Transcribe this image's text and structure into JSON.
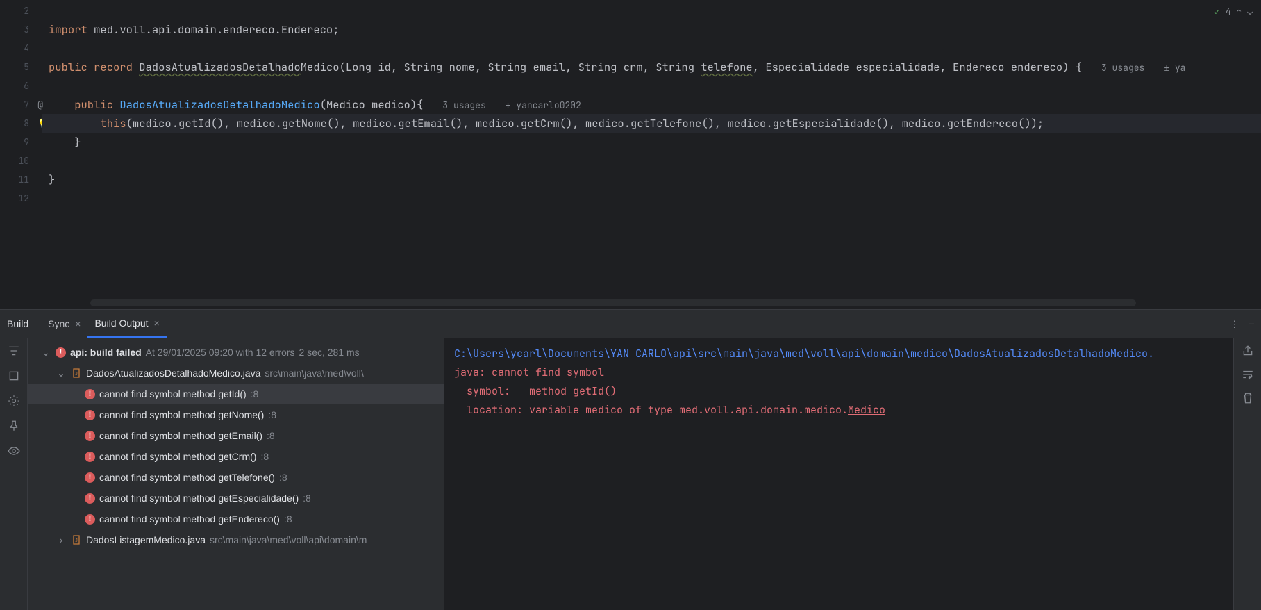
{
  "editor": {
    "status": {
      "count": "4"
    },
    "usages_record": "3 usages",
    "usages_ctor": "3 usages",
    "author_icon": "±",
    "author": "yancarlo0202",
    "lines": {
      "2": "",
      "3_kw": "import",
      "3_rest": " med.voll.api.domain.endereco.Endereco;",
      "4": "",
      "5_pre": "public record ",
      "5_under": "DadosAtualizadosDetalhado",
      "5_after": "Medico(Long id, String nome, String email, String crm, String ",
      "5_tel": "telefone",
      "5_end": ", Especialidade especialidade, Endereco endereco) {",
      "6": "",
      "7_kw": "public",
      "7_name": "DadosAtualizadosDetalhadoMedico",
      "7_params": "(Medico medico){",
      "8_this": "this",
      "8_p1": "(medico",
      "8_rest": ".getId(), medico.getNome(), medico.getEmail(), medico.getCrm(), medico.getTelefone(), medico.getEspecialidade(), medico.getEndereco());",
      "9": "    }",
      "10": "",
      "11": "}",
      "12": ""
    },
    "gutter_numbers": [
      "2",
      "3",
      "4",
      "5",
      "6",
      "7",
      "8",
      "9",
      "10",
      "11",
      "12"
    ]
  },
  "panel": {
    "title": "Build",
    "tabs": [
      {
        "label": "Sync",
        "closable": true,
        "active": false
      },
      {
        "label": "Build Output",
        "closable": true,
        "active": true
      }
    ],
    "tree": {
      "root": {
        "prefix": "api:",
        "status": "build failed",
        "time": "At 29/01/2025 09:20 with 12 errors",
        "duration": "2 sec, 281 ms"
      },
      "file1": {
        "name": "DadosAtualizadosDetalhadoMedico.java",
        "path": "src\\main\\java\\med\\voll\\"
      },
      "errors": [
        {
          "msg": "cannot find symbol method getId()",
          "line": ":8"
        },
        {
          "msg": "cannot find symbol method getNome()",
          "line": ":8"
        },
        {
          "msg": "cannot find symbol method getEmail()",
          "line": ":8"
        },
        {
          "msg": "cannot find symbol method getCrm()",
          "line": ":8"
        },
        {
          "msg": "cannot find symbol method getTelefone()",
          "line": ":8"
        },
        {
          "msg": "cannot find symbol method getEspecialidade()",
          "line": ":8"
        },
        {
          "msg": "cannot find symbol method getEndereco()",
          "line": ":8"
        }
      ],
      "file2": {
        "name": "DadosListagemMedico.java",
        "path": "src\\main\\java\\med\\voll\\api\\domain\\m"
      }
    },
    "detail": {
      "path": "C:\\Users\\ycarl\\Documents\\YAN CARLO\\api\\src\\main\\java\\med\\voll\\api\\domain\\medico\\DadosAtualizadosDetalhadoMedico.",
      "l1": "java: cannot find symbol",
      "l2": "  symbol:   method getId()",
      "l3_pre": "  location: variable medico of type med.voll.api.domain.medico.",
      "l3_link": "Medico"
    }
  }
}
